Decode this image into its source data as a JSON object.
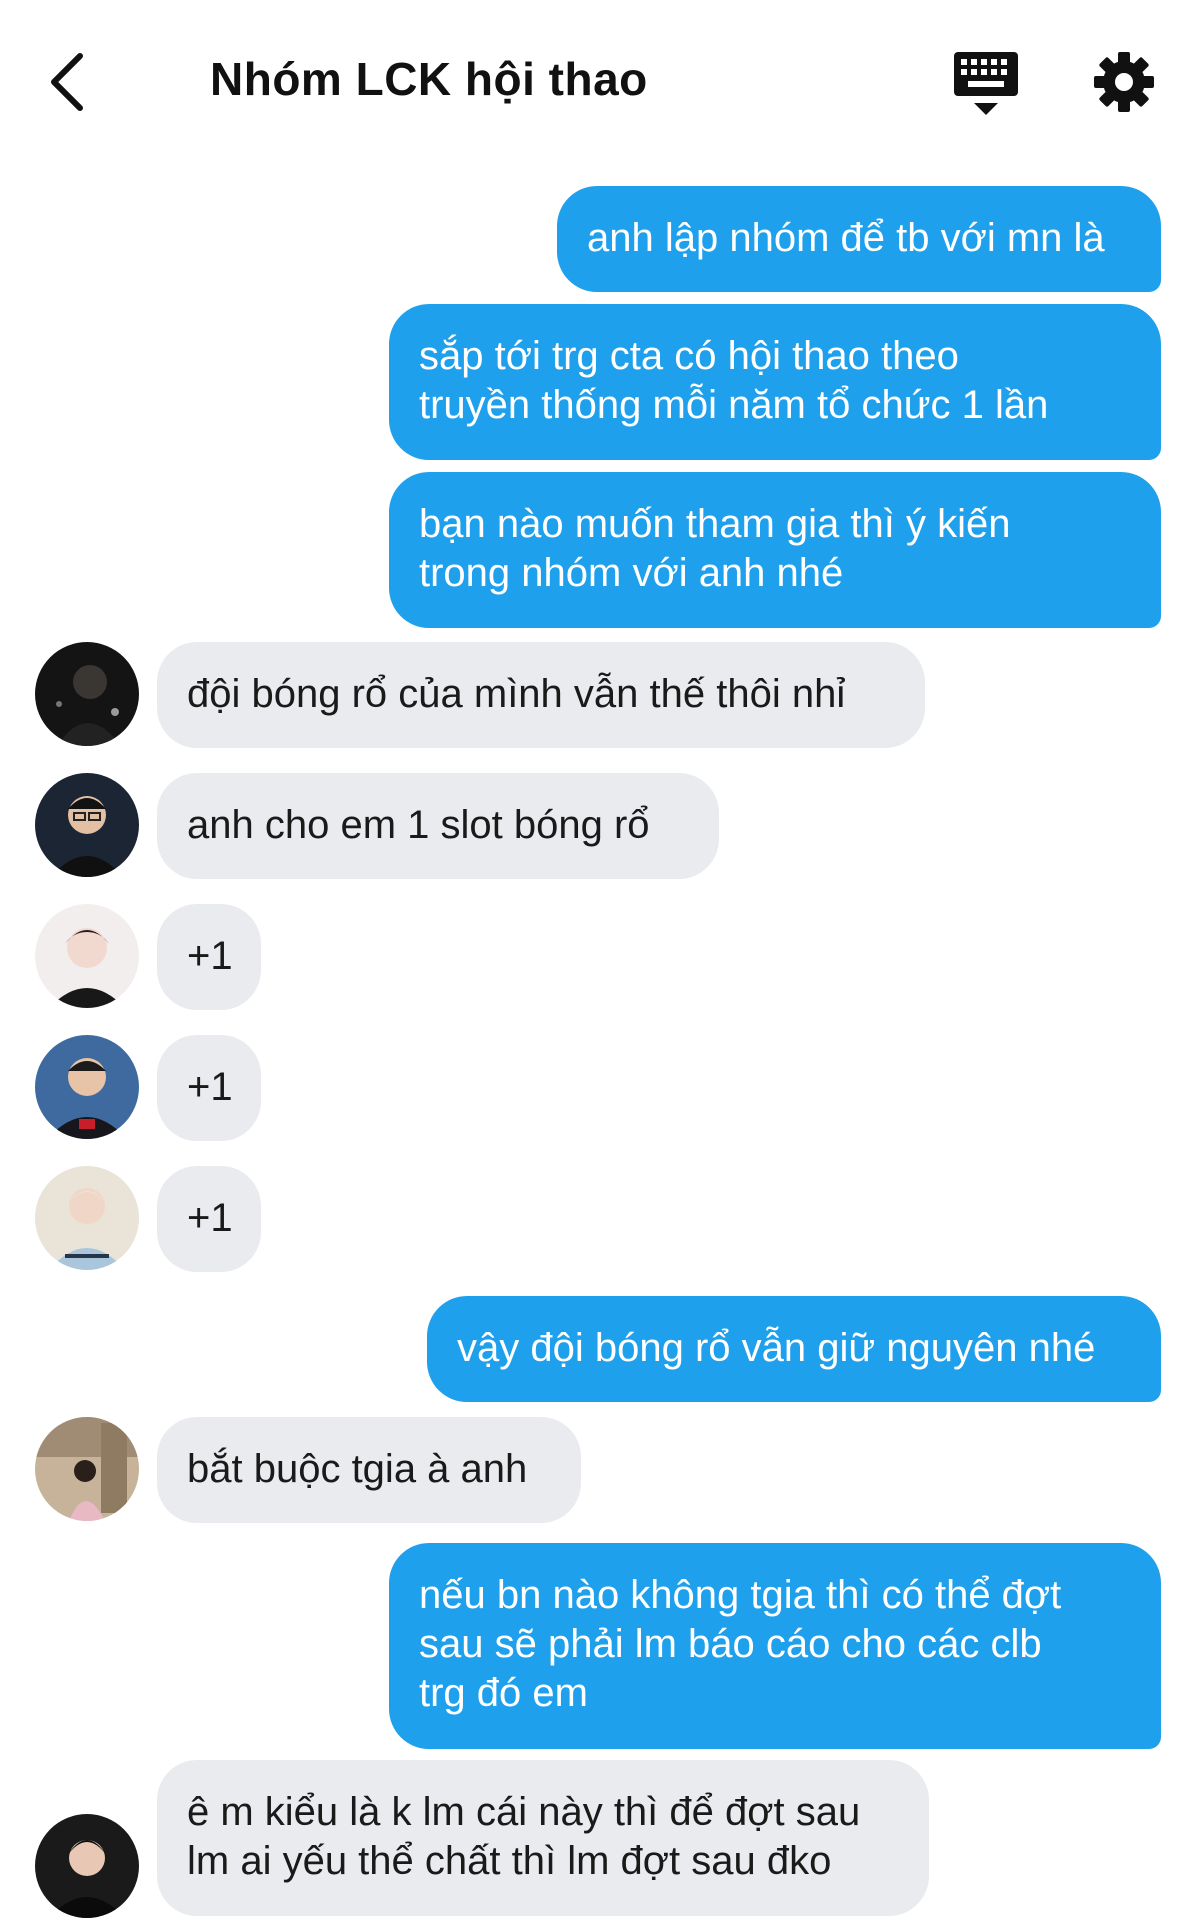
{
  "header": {
    "title": "Nhóm LCK hội thao",
    "back_icon": "chevron-left-icon",
    "keyboard_icon": "keyboard-icon",
    "settings_icon": "gear-icon"
  },
  "colors": {
    "outgoing_bubble": "#1fa0ec",
    "incoming_bubble": "#e9ebee",
    "outgoing_text": "#ffffff",
    "incoming_text": "#1a1a1a"
  },
  "messages": [
    {
      "direction": "out",
      "text": "anh lập nhóm để tb với mn là"
    },
    {
      "direction": "out",
      "text": "sắp tới trg cta có hội thao theo\ntruyền thống mỗi năm tổ chức 1 lần"
    },
    {
      "direction": "out",
      "text": "bạn nào muốn tham gia thì ý kiến\ntrong nhóm với anh nhé"
    },
    {
      "direction": "in",
      "text": "đội bóng rổ của mình vẫn thế thôi nhỉ"
    },
    {
      "direction": "in",
      "text": "anh cho em 1 slot bóng rổ"
    },
    {
      "direction": "in",
      "text": "+1"
    },
    {
      "direction": "in",
      "text": "+1"
    },
    {
      "direction": "in",
      "text": "+1"
    },
    {
      "direction": "out",
      "text": "vậy đội bóng rổ vẫn giữ nguyên nhé"
    },
    {
      "direction": "in",
      "text": "bắt buộc tgia à anh"
    },
    {
      "direction": "out",
      "text": "nếu bn nào không tgia thì có thể đợt\nsau sẽ phải lm báo cáo cho các clb\ntrg đó em"
    },
    {
      "direction": "in",
      "text": "ê m kiểu là k lm cái này thì để đợt sau\nlm ai yếu thể chất thì lm đợt sau đko"
    }
  ]
}
